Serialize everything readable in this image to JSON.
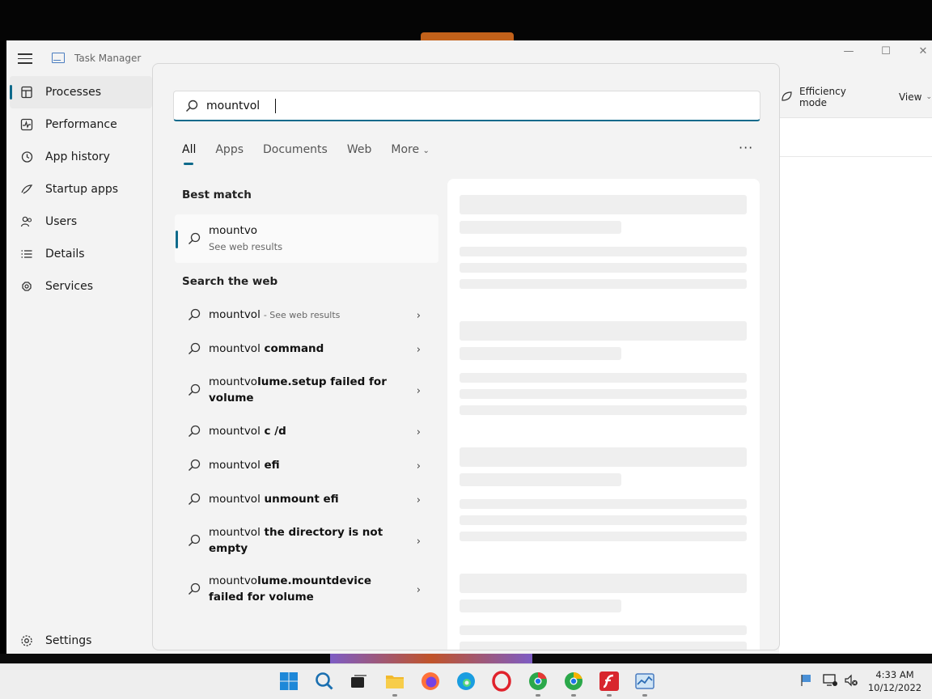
{
  "task_manager": {
    "title": "Task Manager",
    "nav": [
      {
        "label": "Processes",
        "icon": "processes-icon"
      },
      {
        "label": "Performance",
        "icon": "performance-icon"
      },
      {
        "label": "App history",
        "icon": "app-history-icon"
      },
      {
        "label": "Startup apps",
        "icon": "startup-apps-icon"
      },
      {
        "label": "Users",
        "icon": "users-icon"
      },
      {
        "label": "Details",
        "icon": "details-icon"
      },
      {
        "label": "Services",
        "icon": "services-icon"
      }
    ],
    "settings_label": "Settings",
    "toolbar": {
      "efficiency_label": "Efficiency mode",
      "view_label": "View"
    }
  },
  "search": {
    "query": "mountvol",
    "tabs": [
      "All",
      "Apps",
      "Documents",
      "Web",
      "More"
    ],
    "active_tab": "All",
    "best_match_heading": "Best match",
    "best_match": {
      "title": "mountvo",
      "subtitle": "See web results"
    },
    "web_heading": "Search the web",
    "web_results": [
      {
        "prefix": "mountvol",
        "suffix": "",
        "sub": "- See web results"
      },
      {
        "prefix": "mountvol",
        "suffix": " command",
        "sub": ""
      },
      {
        "prefix": "mountvo",
        "suffix": "lume.setup failed for volume",
        "sub": ""
      },
      {
        "prefix": "mountvol",
        "suffix": " c /d",
        "sub": ""
      },
      {
        "prefix": "mountvol",
        "suffix": " efi",
        "sub": ""
      },
      {
        "prefix": "mountvol",
        "suffix": " unmount efi",
        "sub": ""
      },
      {
        "prefix": "mountvol",
        "suffix": " the directory is not empty",
        "sub": ""
      },
      {
        "prefix": "mountvo",
        "suffix": "lume.mountdevice failed for volume",
        "sub": ""
      }
    ]
  },
  "taskbar": {
    "apps": [
      "start-icon",
      "search-icon",
      "task-view-icon",
      "file-explorer-icon",
      "firefox-icon",
      "edge-icon",
      "opera-icon",
      "chrome-icon",
      "chrome-profile-icon",
      "flash-icon",
      "task-manager-icon"
    ],
    "clock_time": "4:33 AM",
    "clock_date": "10/12/2022"
  },
  "colors": {
    "accent": "#0f6a8b",
    "flyout_bg": "#f3f3f3"
  }
}
